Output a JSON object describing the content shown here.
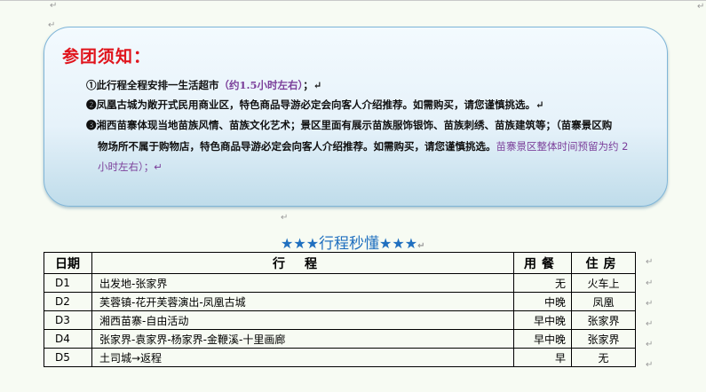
{
  "marks": {
    "para": "↵"
  },
  "notice": {
    "title": "参团须知：",
    "item1_text": "①此行程全程安排一生活超市",
    "item1_note": "（约1.5小时左右）",
    "item1_end": "；↵",
    "item2_text": "❷凤凰古城为敞开式民用商业区，特色商品导游必定会向客人介绍推荐。如需购买，请您谨慎挑选。↵",
    "item3_line1": "❸湘西苗寨体现当地苗族风情、苗族文化艺术；景区里面有展示苗族服饰银饰、苗族刺绣、苗族建筑等；（苗寨景区购",
    "item3_line2a": "物场所不属于购物店，特色商品导游必定会向客人介绍推荐。如需购买，请您谨慎挑选。",
    "item3_line2b": "苗寨景区整体时间预留为约 2",
    "item3_line3": "小时左右）；↵"
  },
  "itinerary": {
    "title_stars_left": "★★★",
    "title_text": "行程秒懂",
    "title_stars_right": "★★★",
    "headers": {
      "day": "日期",
      "route": "行程",
      "meal": "用餐",
      "stay": "住房"
    },
    "rows": [
      {
        "day": "D1",
        "route": "出发地-张家界",
        "meal": "无",
        "stay": "火车上"
      },
      {
        "day": "D2",
        "route": "芙蓉镇-花开芙蓉演出-凤凰古城",
        "meal": "中晚",
        "stay": "凤凰"
      },
      {
        "day": "D3",
        "route": "湘西苗寨-自由活动",
        "meal": "早中晚",
        "stay": "张家界"
      },
      {
        "day": "D4",
        "route": "张家界-袁家界-杨家界-金鞭溪-十里画廊",
        "meal": "早中晚",
        "stay": "张家界"
      },
      {
        "day": "D5",
        "route": "土司城→返程",
        "meal": "早",
        "stay": "无"
      }
    ]
  }
}
